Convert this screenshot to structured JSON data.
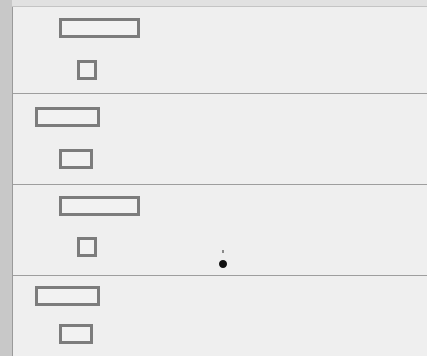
{
  "rows": [
    {
      "field_value": "",
      "checked": false
    },
    {
      "field_value": "",
      "checked": false
    },
    {
      "field_value": "",
      "checked": false
    },
    {
      "field_value": "",
      "checked": false
    }
  ],
  "colors": {
    "panel_bg": "#efefef",
    "border": "#7c7c7c",
    "divider": "#9e9e9e"
  }
}
